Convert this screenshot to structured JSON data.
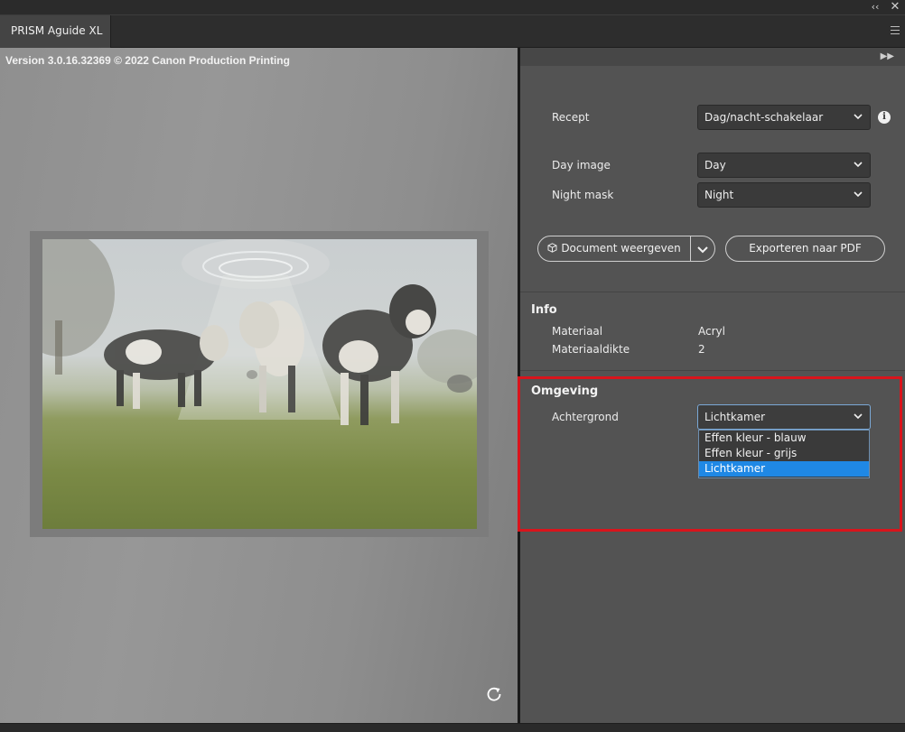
{
  "window": {
    "collapse_icon": "double-chevron-left-icon",
    "close_icon": "close-icon"
  },
  "tab": {
    "label": "PRISM Aguide XL"
  },
  "panel_menu_icon": "hamburger-menu-icon",
  "preview": {
    "version_text": "Version 3.0.16.32369 © 2022 Canon Production Printing",
    "image_description_icon": "photo-cows-ufo",
    "reset_icon": "rotate-reset-icon"
  },
  "right_panel": {
    "expand_icon": "double-chevron-right-icon",
    "recept": {
      "label": "Recept",
      "value": "Dag/nacht-schakelaar"
    },
    "day_image": {
      "label": "Day image",
      "value": "Day"
    },
    "night_mask": {
      "label": "Night mask",
      "value": "Night"
    },
    "buttons": {
      "document_view": "Document weergeven",
      "export_pdf": "Exporteren naar PDF"
    },
    "info": {
      "heading": "Info",
      "rows": [
        {
          "label": "Materiaal",
          "value": "Acryl"
        },
        {
          "label": "Materiaaldikte",
          "value": "2"
        }
      ]
    },
    "environment": {
      "heading": "Omgeving",
      "background_label": "Achtergrond",
      "background_value": "Lichtkamer",
      "options": [
        "Effen kleur - blauw",
        "Effen kleur - grijs",
        "Lichtkamer"
      ],
      "selected_index": 2
    }
  },
  "colors": {
    "selected_option": "#1f88e5",
    "highlight_box": "#d9141c",
    "panel_bg": "#535353"
  }
}
